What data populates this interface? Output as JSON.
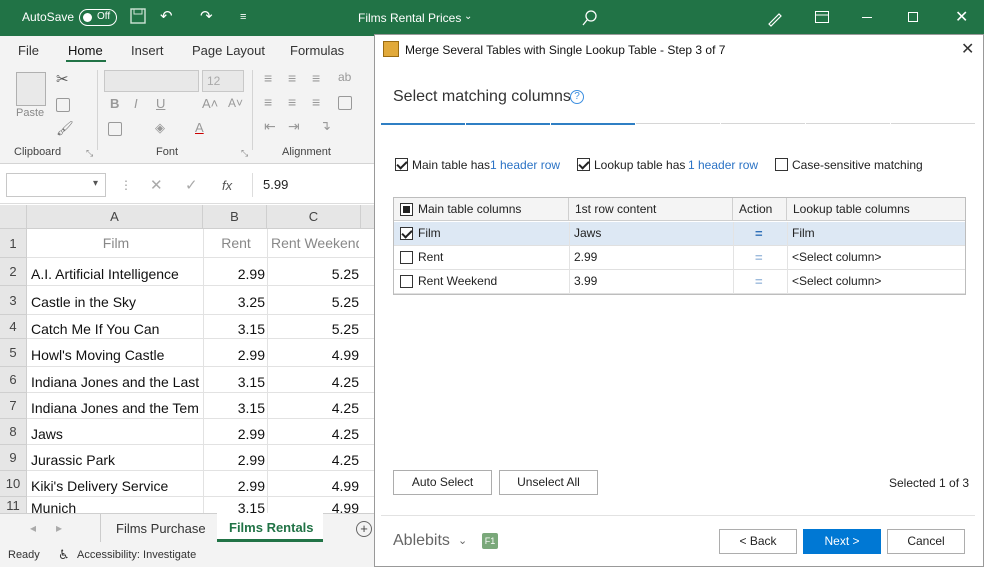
{
  "titlebar": {
    "autosave_label": "AutoSave",
    "autosave_state": "Off",
    "document_title": "Films Rental Prices",
    "controls": [
      "save-icon",
      "undo-icon",
      "redo-icon",
      "customize-icon"
    ]
  },
  "menu": {
    "items": [
      "File",
      "Home",
      "Insert",
      "Page Layout",
      "Formulas"
    ],
    "active": "Home"
  },
  "ribbon": {
    "groups": [
      "Clipboard",
      "Font",
      "Alignment"
    ],
    "paste_label": "Paste",
    "font_size": "12"
  },
  "formula_bar": {
    "name_box": "",
    "fx_label": "fx",
    "value": "5.99"
  },
  "sheet": {
    "columns": [
      "A",
      "B",
      "C"
    ],
    "header_row": {
      "num": "1",
      "a": "Film",
      "b": "Rent",
      "c": "Rent Weekend"
    },
    "rows": [
      {
        "num": "2",
        "a": "A.I. Artificial Intelligence",
        "b": "2.99",
        "c": "5.25"
      },
      {
        "num": "3",
        "a": "Castle in the Sky",
        "b": "3.25",
        "c": "5.25"
      },
      {
        "num": "4",
        "a": "Catch Me If You Can",
        "b": "3.15",
        "c": "5.25"
      },
      {
        "num": "5",
        "a": "Howl's Moving Castle",
        "b": "2.99",
        "c": "4.99"
      },
      {
        "num": "6",
        "a": "Indiana Jones and the Last",
        "b": "3.15",
        "c": "4.25"
      },
      {
        "num": "7",
        "a": "Indiana Jones and the Tem",
        "b": "3.15",
        "c": "4.25"
      },
      {
        "num": "8",
        "a": "Jaws",
        "b": "2.99",
        "c": "4.25"
      },
      {
        "num": "9",
        "a": "Jurassic Park",
        "b": "2.99",
        "c": "4.25"
      },
      {
        "num": "10",
        "a": "Kiki's Delivery Service",
        "b": "2.99",
        "c": "4.99"
      },
      {
        "num": "11",
        "a": "Munich",
        "b": "3.15",
        "c": "4.99"
      }
    ]
  },
  "sheet_tabs": {
    "tabs": [
      "Films Purchase",
      "Films Rentals"
    ],
    "active": "Films Rentals"
  },
  "status": {
    "ready": "Ready",
    "accessibility": "Accessibility: Investigate"
  },
  "dialog": {
    "title": "Merge Several Tables with Single Lookup Table - Step 3 of 7",
    "heading": "Select matching columns",
    "progress_steps": 7,
    "progress_done": 3,
    "options": {
      "main_prefix": "Main table has",
      "main_link": "1 header row",
      "lookup_prefix": "Lookup table has",
      "lookup_link": "1 header row",
      "case_label": "Case-sensitive matching"
    },
    "grid": {
      "headers": [
        "Main table columns",
        "1st row content",
        "Action",
        "Lookup table columns"
      ],
      "rows": [
        {
          "checked": true,
          "main": "Film",
          "content": "Jaws",
          "action": "=",
          "lookup": "Film"
        },
        {
          "checked": false,
          "main": "Rent",
          "content": "2.99",
          "action": "=",
          "lookup": "<Select column>"
        },
        {
          "checked": false,
          "main": "Rent Weekend",
          "content": "3.99",
          "action": "=",
          "lookup": "<Select column>"
        }
      ]
    },
    "auto_select": "Auto Select",
    "unselect_all": "Unselect All",
    "selected_count": "Selected 1 of 3",
    "brand": "Ablebits",
    "help_badge": "F1",
    "back": "< Back",
    "next": "Next >",
    "cancel": "Cancel"
  },
  "colors": {
    "excel_green": "#217346",
    "accent_blue": "#0078d4",
    "selected_row": "#dde8f4"
  }
}
